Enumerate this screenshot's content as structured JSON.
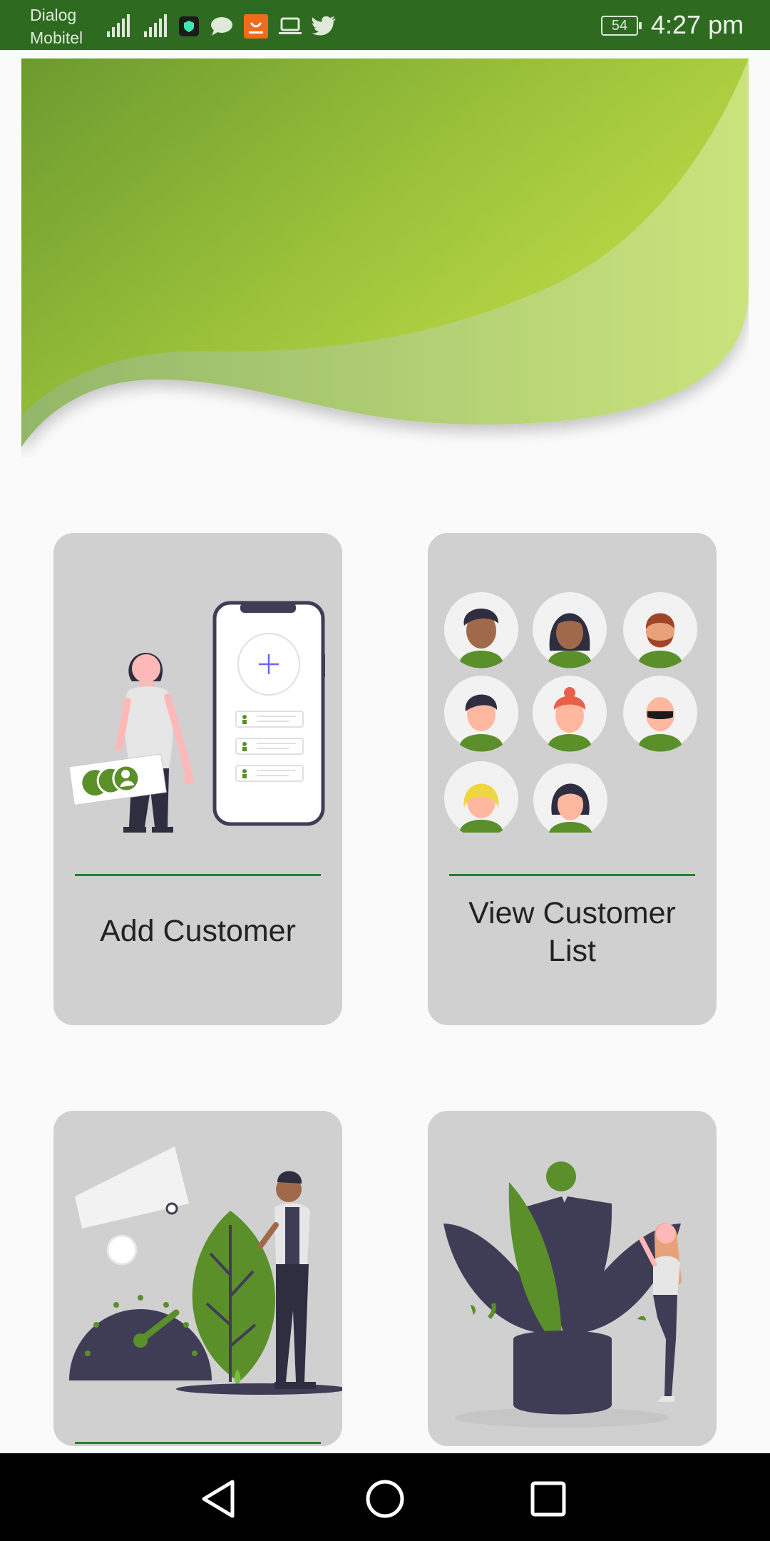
{
  "status_bar": {
    "carrier_line1": "Dialog",
    "carrier_line2": "Mobitel",
    "battery_level": "54",
    "time": "4:27 pm"
  },
  "cards": [
    {
      "label": "Add Customer"
    },
    {
      "label": "View Customer\nList"
    },
    {
      "label": ""
    },
    {
      "label": ""
    }
  ],
  "colors": {
    "accent": "#2e7d32",
    "status_bar": "#2e6b21",
    "card_bg": "#d0d0d0",
    "illustration_green": "#5a8f2a",
    "illustration_dark": "#3f3d56"
  },
  "nav": {
    "back": "back-icon",
    "home": "home-icon",
    "recents": "recents-icon"
  }
}
